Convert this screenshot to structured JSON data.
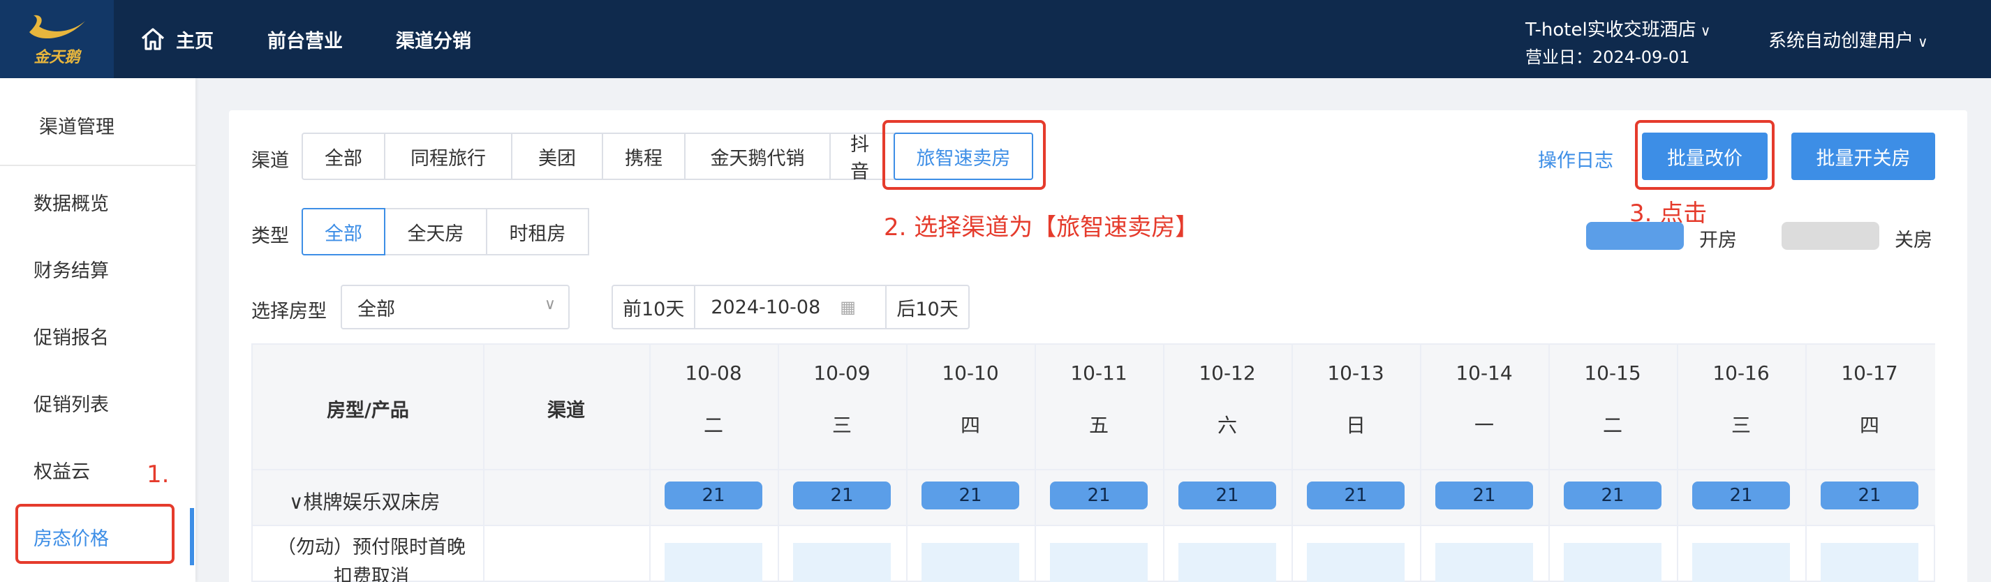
{
  "topbar": {
    "logo_text": "金天鹅",
    "nav": [
      {
        "label": "主页",
        "icon": "home-icon"
      },
      {
        "label": "前台营业"
      },
      {
        "label": "渠道分销"
      }
    ],
    "hotel_name": "T-hotel实收交班酒店",
    "business_day": "营业日：2024-09-01",
    "user": "系统自动创建用户"
  },
  "sidebar": {
    "title": "渠道管理",
    "items": [
      {
        "label": "数据概览"
      },
      {
        "label": "财务结算"
      },
      {
        "label": "促销报名"
      },
      {
        "label": "促销列表"
      },
      {
        "label": "权益云"
      },
      {
        "label": "房态价格",
        "active": true
      }
    ]
  },
  "filters": {
    "channel_label": "渠道",
    "channels": [
      "全部",
      "同程旅行",
      "美团",
      "携程",
      "金天鹅代销",
      "抖音",
      "旅智速卖房"
    ],
    "selected_channel": "旅智速卖房",
    "type_label": "类型",
    "types": [
      "全部",
      "全天房",
      "时租房"
    ],
    "selected_type": "全部",
    "room_type_label": "选择房型",
    "room_type_value": "全部",
    "prev_10": "前10天",
    "date_value": "2024-10-08",
    "next_10": "后10天"
  },
  "actions": {
    "log": "操作日志",
    "batch_price": "批量改价",
    "batch_open_close": "批量开关房"
  },
  "legend": {
    "open": "开房",
    "closed": "关房",
    "open_color": "#5b9ee8",
    "closed_color": "#dcdcdc"
  },
  "annotations": {
    "a1": "1.",
    "a2": "2. 选择渠道为【旅智速卖房】",
    "a3": "3. 点击"
  },
  "table": {
    "col_room": "房型/产品",
    "col_channel": "渠道",
    "dates": [
      {
        "date": "10-08",
        "weekday": "二"
      },
      {
        "date": "10-09",
        "weekday": "三"
      },
      {
        "date": "10-10",
        "weekday": "四"
      },
      {
        "date": "10-11",
        "weekday": "五"
      },
      {
        "date": "10-12",
        "weekday": "六"
      },
      {
        "date": "10-13",
        "weekday": "日"
      },
      {
        "date": "10-14",
        "weekday": "一"
      },
      {
        "date": "10-15",
        "weekday": "二"
      },
      {
        "date": "10-16",
        "weekday": "三"
      },
      {
        "date": "10-17",
        "weekday": "四"
      }
    ],
    "room_type": "∨棋牌娱乐双床房",
    "room_counts": [
      "21",
      "21",
      "21",
      "21",
      "21",
      "21",
      "21",
      "21",
      "21",
      "21"
    ],
    "product_name": "（勿动）预付限时首晚扣费取消"
  }
}
